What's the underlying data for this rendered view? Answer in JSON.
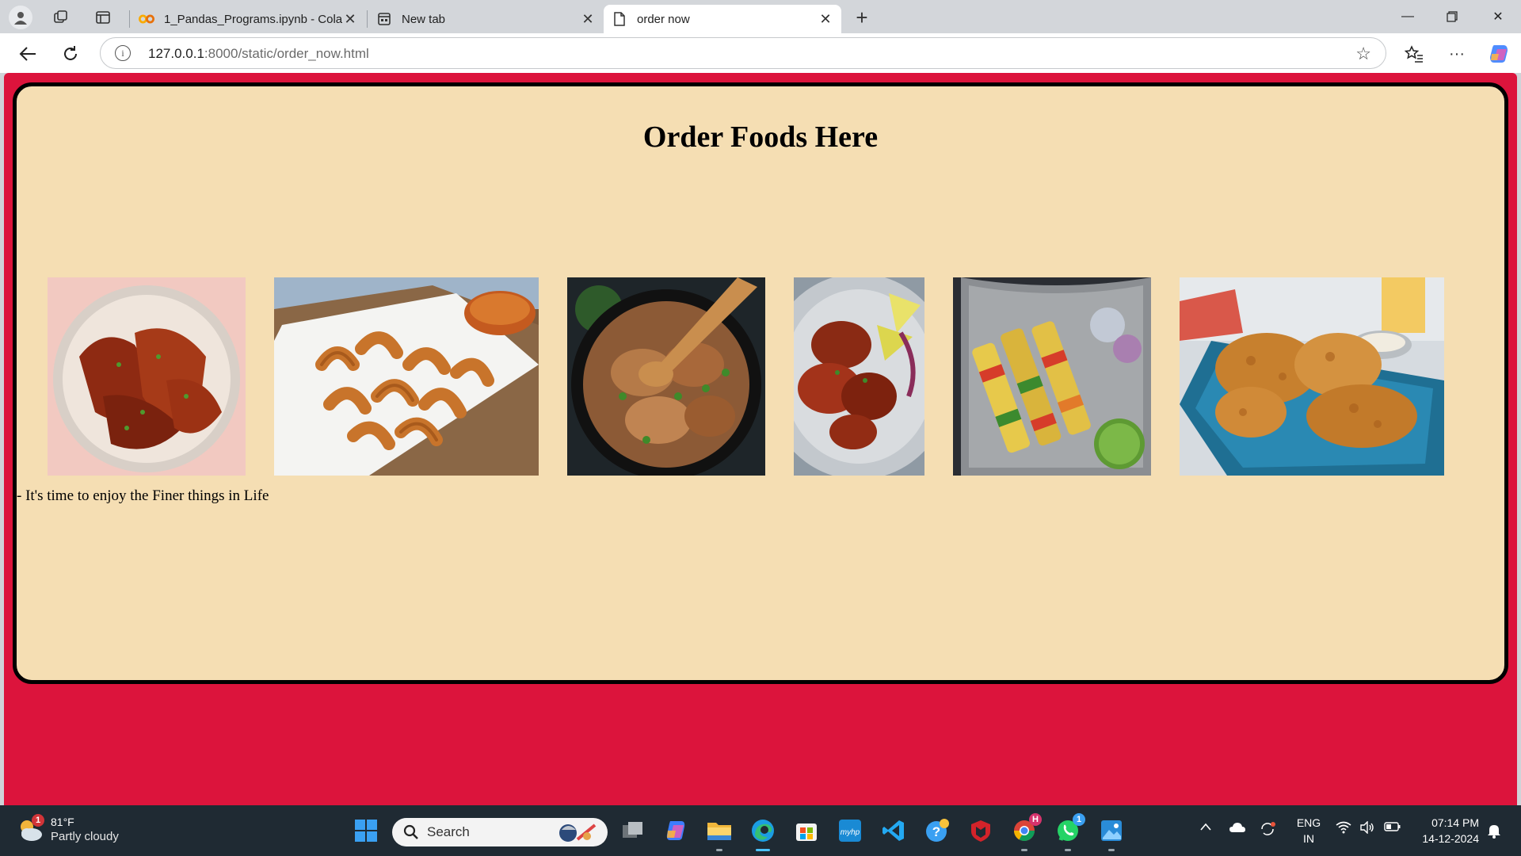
{
  "browser": {
    "tabs": [
      {
        "title": "1_Pandas_Programs.ipynb - Colab",
        "icon": "colab-icon",
        "active": false
      },
      {
        "title": "New tab",
        "icon": "newtab-icon",
        "active": false
      },
      {
        "title": "order now",
        "icon": "page-icon",
        "active": true
      }
    ],
    "address": {
      "host": "127.0.0.1",
      "path": ":8000/static/order_now.html"
    }
  },
  "page": {
    "heading": "Order Foods Here",
    "tagline": "- It's time to enjoy the Finer things in Life",
    "colors": {
      "background": "#dc143c",
      "card": "#f5deb3",
      "border": "#000000"
    },
    "images": [
      {
        "name": "tandoori-fish-image"
      },
      {
        "name": "fried-prawns-image"
      },
      {
        "name": "chicken-curry-pan-image"
      },
      {
        "name": "tandoori-chicken-legs-image"
      },
      {
        "name": "paneer-tikka-skewers-image"
      },
      {
        "name": "fried-chicken-tray-image"
      }
    ]
  },
  "taskbar": {
    "weather": {
      "temp": "81°F",
      "condition": "Partly cloudy",
      "badge": "1"
    },
    "search_placeholder": "Search",
    "language": {
      "line1": "ENG",
      "line2": "IN"
    },
    "clock": {
      "time": "07:14 PM",
      "date": "14-12-2024"
    },
    "chrome_badge": "H",
    "whatsapp_badge": "1"
  }
}
